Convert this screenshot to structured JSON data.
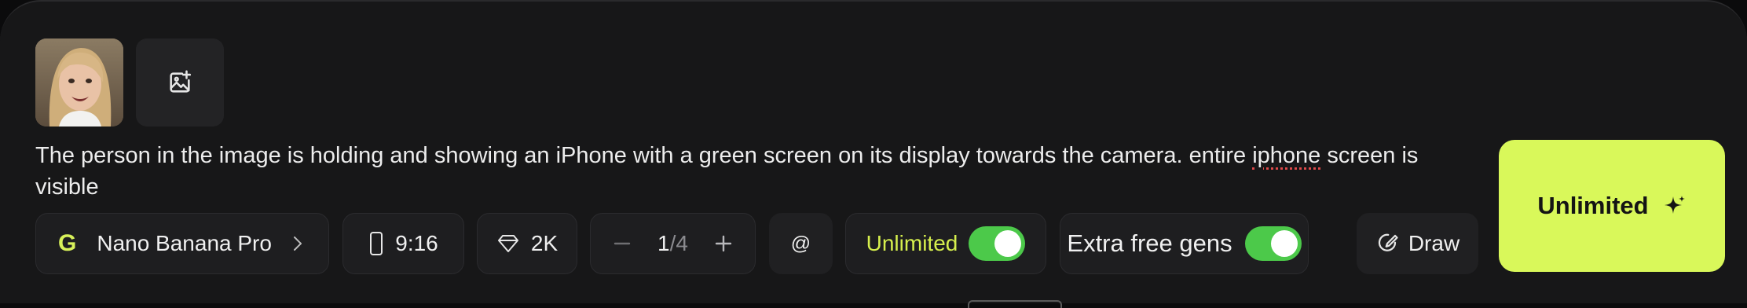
{
  "composer": {
    "prompt_main": "The person in the image is holding and showing an iPhone with a green screen on its display towards the camera. entire ",
    "prompt_flag": "iphone",
    "prompt_rest": " screen is visible"
  },
  "toolbar": {
    "model_label": "Nano Banana Pro",
    "model_logo": "G",
    "aspect_ratio": "9:16",
    "resolution": "2K",
    "count_current": "1",
    "count_total": "/4",
    "mention_label": "@",
    "unlimited_label": "Unlimited",
    "unlimited_enabled": true,
    "extra_free_label": "Extra free gens",
    "extra_free_enabled": true,
    "draw_label": "Draw"
  },
  "generate": {
    "label": "Unlimited"
  },
  "colors": {
    "accent": "#d9f85a",
    "toggle_on": "#4cc94a",
    "panel": "#171718"
  },
  "icons": [
    "add-image-icon",
    "chevron-right-icon",
    "phone-portrait-icon",
    "diamond-icon",
    "minus-icon",
    "plus-icon",
    "draw-icon",
    "sparkle-icon"
  ]
}
